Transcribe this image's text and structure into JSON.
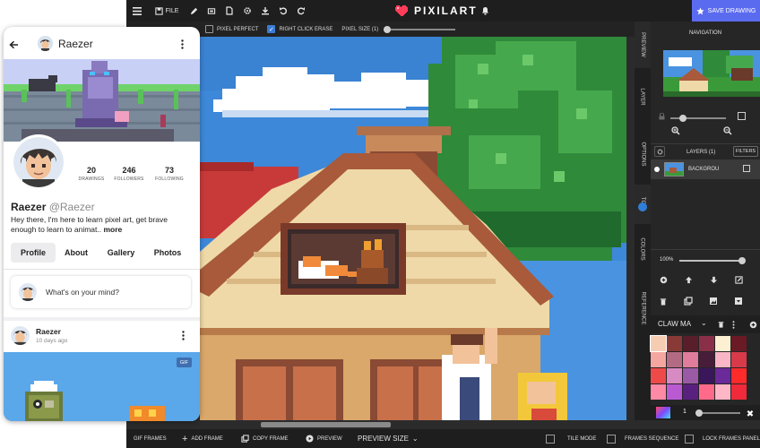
{
  "editor": {
    "topbar": {
      "file_label": "FILE",
      "app_name": "PIXILART",
      "save_label": "SAVE DRAWING",
      "colors": {
        "bar": "#1e1e1e",
        "save": "#5b6bf0",
        "heart": "#ff3d5a"
      }
    },
    "options": {
      "pixel_perfect": {
        "label": "PIXEL PERFECT",
        "checked": false
      },
      "right_click_erase": {
        "label": "RIGHT CLICK ERASE",
        "checked": true
      },
      "pixel_size_label": "PIXEL SIZE (1)"
    },
    "side_tabs": [
      "PREVIEW",
      "LAYER",
      "OPTIONS",
      "TOOL",
      "COLORS",
      "REFERENCE"
    ],
    "panel": {
      "navigation_title": "NAVIGATION",
      "layers_label": "LAYERS (1)",
      "filters_label": "FILTERS",
      "layer_name": "BACKGROU",
      "opacity_label": "100%",
      "brush_name": "CLAW MA",
      "brush_size": "1",
      "palette": [
        "#f6cdb2",
        "#8a3a36",
        "#5a1d2a",
        "#8a2f48",
        "#fdf0d2",
        "#6a1a24",
        "#f6a6a0",
        "#b36b84",
        "#e07c9c",
        "#481d3a",
        "#f8b6c6",
        "#d83a4a",
        "#ef4a4a",
        "#d88ac2",
        "#9a5aa6",
        "#3a165a",
        "#6a2a9a",
        "#ff2a2a",
        "#ff8aa6",
        "#ba5ad2",
        "#5a2080",
        "#ff6a8a",
        "#ffb6c6",
        "#f02a3a"
      ]
    },
    "bottom": {
      "gif_frames": "GIF FRAMES",
      "add_frame": "ADD FRAME",
      "copy_frame": "COPY FRAME",
      "preview": "PREVIEW",
      "preview_size": "PREVIEW SIZE",
      "tile_mode": "TILE MODE",
      "frames_sequence": "FRAMES SEQUENCE",
      "lock_frames_panel": "LOCK FRAMES PANEL"
    }
  },
  "profile": {
    "header_name": "Raezer",
    "display_name": "Raezer",
    "handle": "@Raezer",
    "stats": [
      {
        "value": "20",
        "label": "DRAWINGS"
      },
      {
        "value": "246",
        "label": "FOLLOWERS"
      },
      {
        "value": "73",
        "label": "FOLLOWING"
      }
    ],
    "bio_line1": "Hey there, I'm here to learn pixel art, get brave",
    "bio_line2": "enough to learn to animat..",
    "bio_more": "more",
    "tabs": [
      "Profile",
      "About",
      "Gallery",
      "Photos"
    ],
    "active_tab": "Profile",
    "composer_placeholder": "What's on your mind?",
    "post": {
      "author": "Raezer",
      "time": "10 days ago",
      "badge": "GIF"
    }
  }
}
